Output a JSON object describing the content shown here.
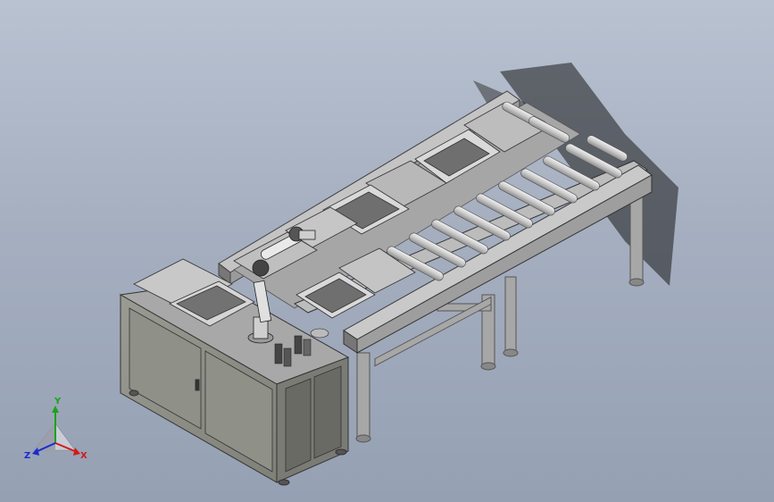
{
  "viewport": {
    "background_top": "#b9c2d1",
    "background_bottom": "#95a0b3"
  },
  "triad": {
    "x_label": "X",
    "y_label": "Y",
    "z_label": "Z",
    "x_color": "#d11a1a",
    "y_color": "#1aa31a",
    "z_color": "#1a2ad1"
  },
  "model": {
    "frame_color": "#9a9a9a",
    "panel_color": "#8f918a",
    "roller_color": "#d8d8d8",
    "cabinet_front_color": "#8e8f86"
  }
}
